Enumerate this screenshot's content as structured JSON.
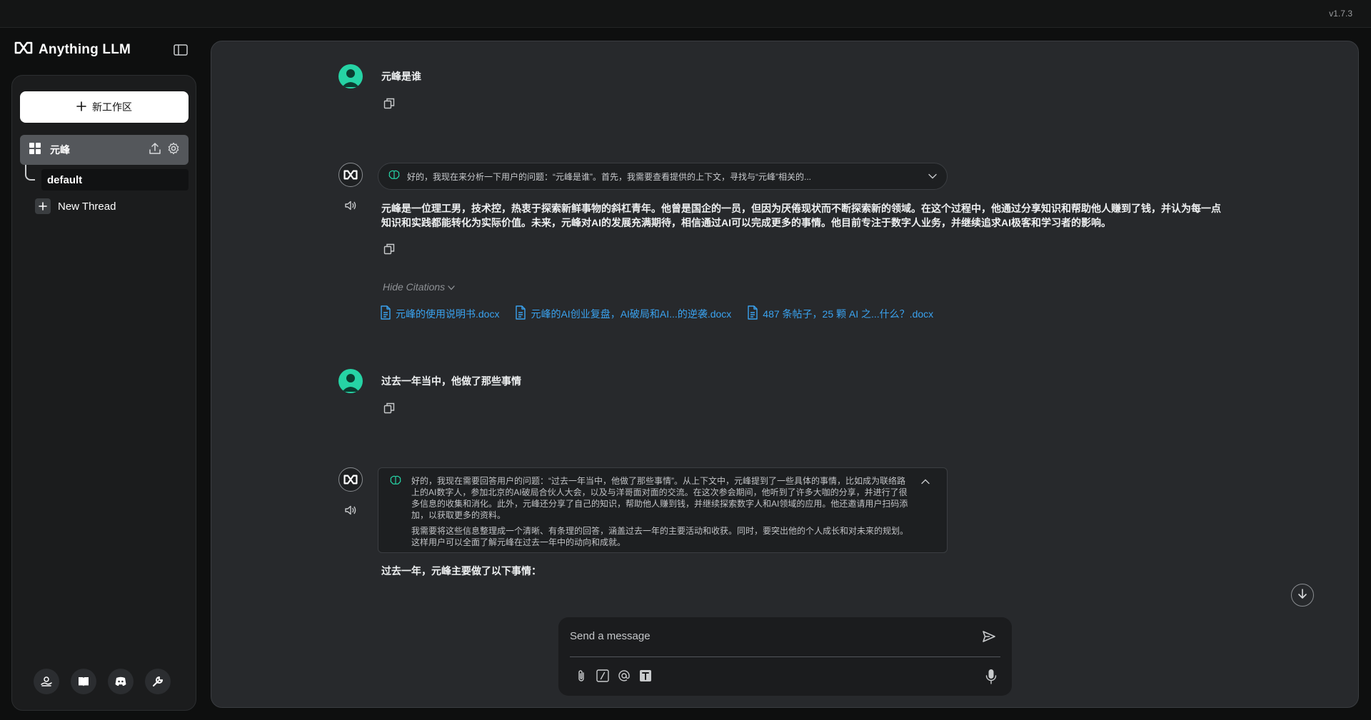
{
  "app": {
    "version": "v1.7.3",
    "brand_name": "Anything LLM"
  },
  "sidebar": {
    "new_workspace_label": "新工作区",
    "workspace": {
      "name": "元峰",
      "threads": [
        {
          "label": "default"
        }
      ],
      "new_thread_label": "New Thread"
    },
    "footer_icons": [
      "community-hub-icon",
      "docs-book-icon",
      "discord-icon",
      "settings-wrench-icon"
    ]
  },
  "chat": {
    "messages": [
      {
        "role": "user",
        "text": "元峰是谁"
      },
      {
        "role": "assistant",
        "thought_preview": "好的，我现在来分析一下用户的问题：“元峰是谁”。首先，我需要查看提供的上下文，寻找与“元峰”相关的...",
        "answer_line1": "元峰是一位理工男，技术控，热衷于探索新鲜事物的斜杠青年。他曾是国企的一员，但因为厌倦现状而不断探索新的领域。在这个过程中，他通过分享知识和帮助他人赚到了钱，并认为每一点",
        "answer_line2": "知识和实践都能转化为实际价值。未来，元峰对AI的发展充满期待，相信通过AI可以完成更多的事情。他目前专注于数字人业务，并继续追求AI极客和学习者的影响。",
        "hide_citations_label": "Hide Citations",
        "citations": [
          "元峰的使用说明书.docx",
          "元峰的AI创业复盘，AI破局和AI...的逆袭.docx",
          "487 条帖子，25 颗 AI 之...什么？.docx"
        ]
      },
      {
        "role": "user",
        "text": "过去一年当中，他做了那些事情"
      },
      {
        "role": "assistant",
        "thought_para1_line1": "好的，我现在需要回答用户的问题：“过去一年当中，他做了那些事情”。从上下文中，元峰提到了一些具体的事情，比如成为联络路",
        "thought_para1_line2": "上的AI数字人，参加北京的AI破局合伙人大会，以及与洋哥面对面的交流。在这次参会期间，他听到了许多大咖的分享，并进行了很",
        "thought_para1_line3": "多信息的收集和消化。此外，元峰还分享了自己的知识，帮助他人赚到钱，并继续探索数字人和AI领域的应用。他还邀请用户扫码添",
        "thought_para1_line4": "加，以获取更多的资料。",
        "thought_para2_line1": "我需要将这些信息整理成一个清晰、有条理的回答，涵盖过去一年的主要活动和收获。同时，要突出他的个人成长和对未来的规划。",
        "thought_para2_line2": "这样用户可以全面了解元峰在过去一年中的动向和成就。",
        "answer": "过去一年，元峰主要做了以下事情："
      }
    ]
  },
  "composer": {
    "placeholder": "Send a message"
  },
  "colors": {
    "accent_user": "#26d3a5",
    "citation_link": "#3aa3f0",
    "background": "#0e0f0f",
    "panel": "#27292c"
  }
}
